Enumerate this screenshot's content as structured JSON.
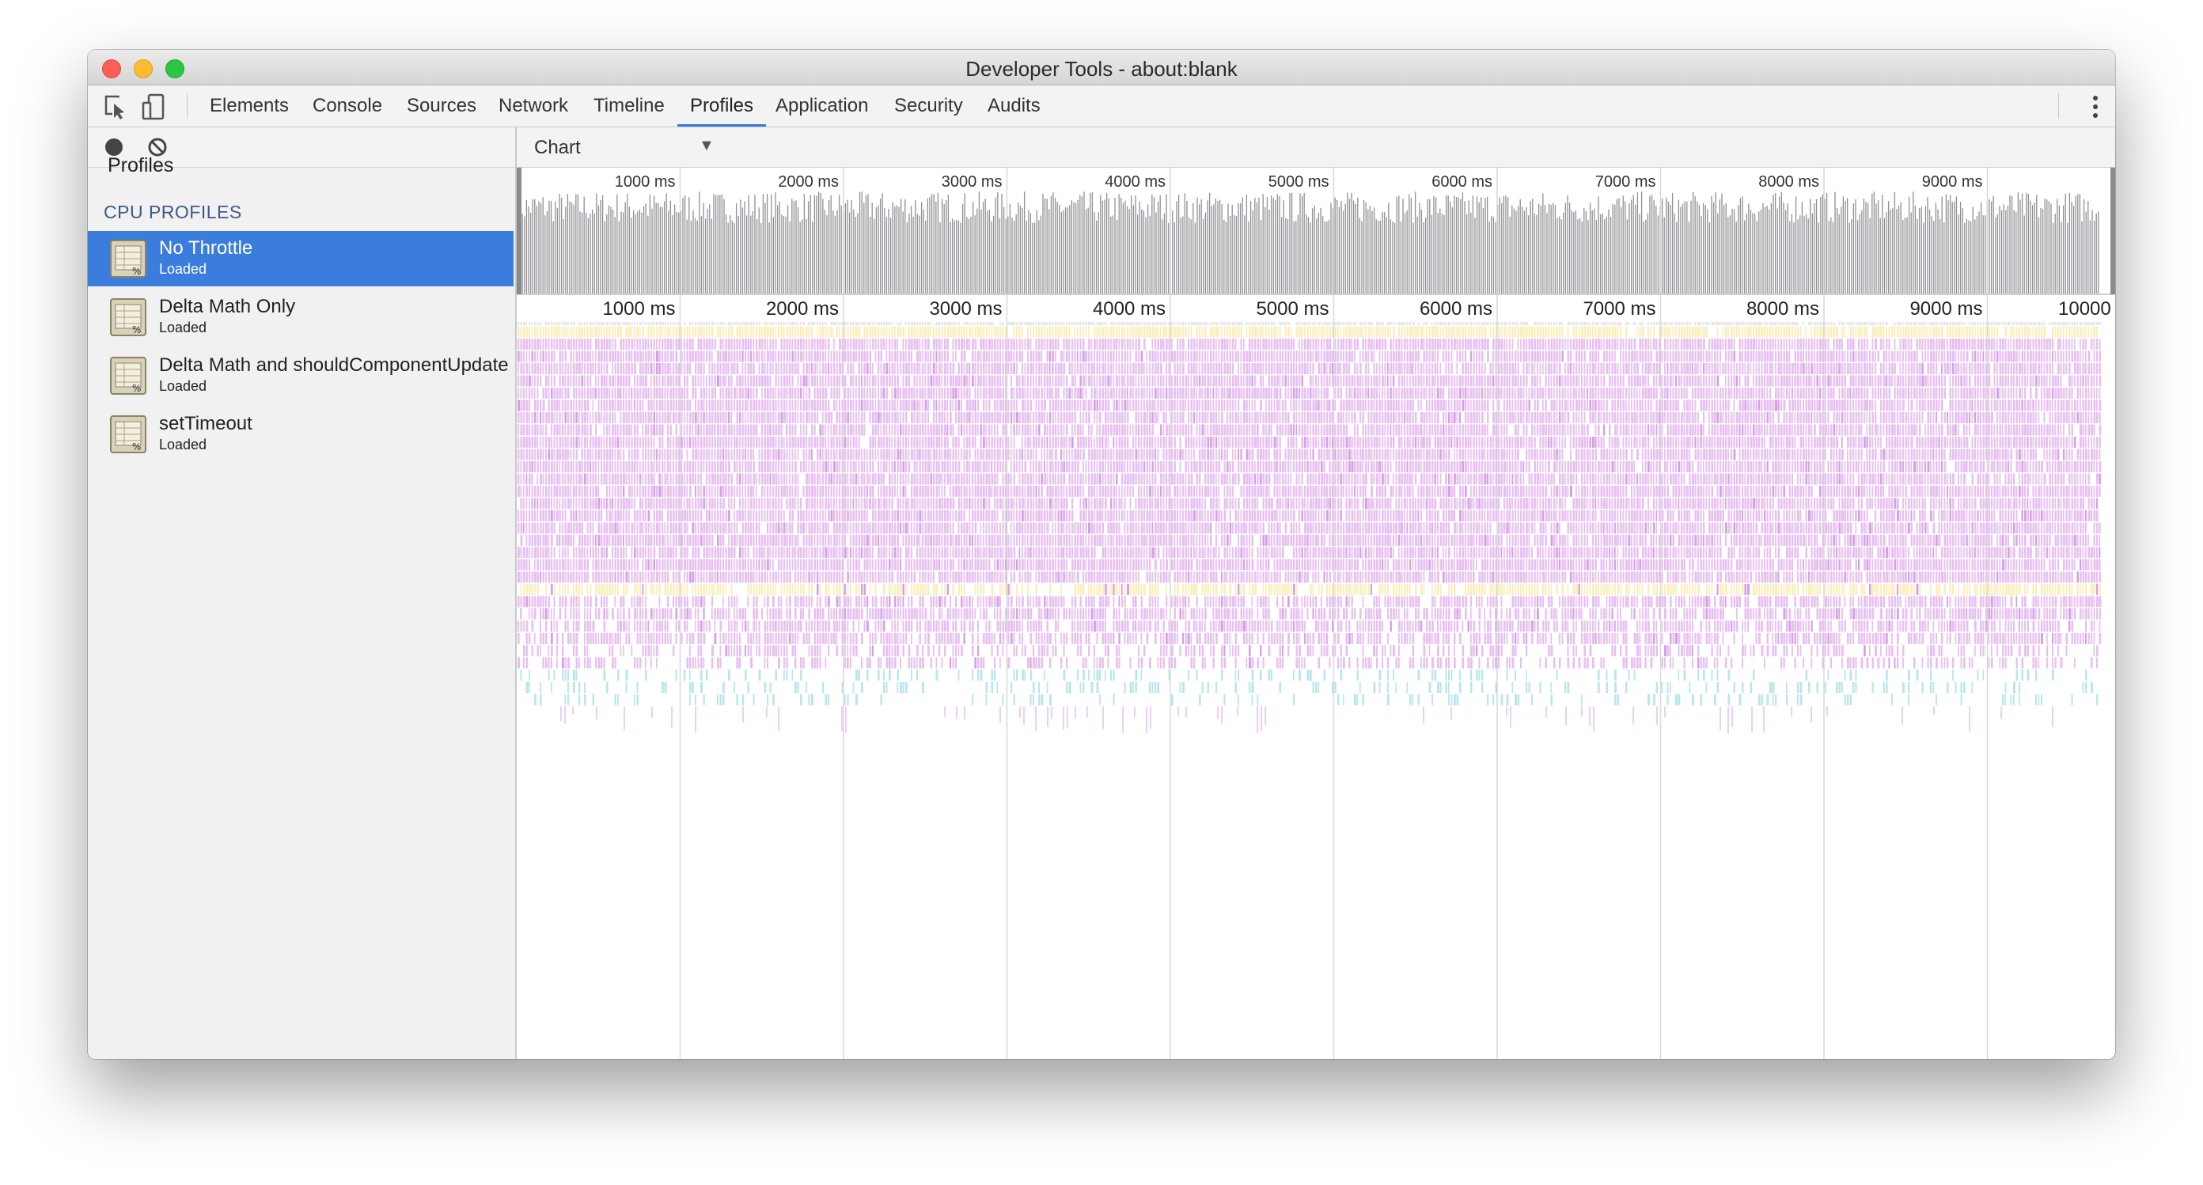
{
  "window": {
    "title": "Developer Tools - about:blank"
  },
  "toolbar": {
    "icons": [
      "inspect-element-icon",
      "device-toolbar-icon",
      "more-options-icon"
    ],
    "tabs": [
      "Elements",
      "Console",
      "Sources",
      "Network",
      "Timeline",
      "Profiles",
      "Application",
      "Security",
      "Audits"
    ],
    "active_tab": "Profiles",
    "accent_color": "#3879d9"
  },
  "sidebar": {
    "toolbar_icons": [
      "record-icon",
      "clear-icon"
    ],
    "heading": "Profiles",
    "section": "CPU PROFILES",
    "profiles": [
      {
        "name": "No Throttle",
        "status": "Loaded",
        "selected": true
      },
      {
        "name": "Delta Math Only",
        "status": "Loaded",
        "selected": false
      },
      {
        "name": "Delta Math and shouldComponentUpdate",
        "status": "Loaded",
        "selected": false
      },
      {
        "name": "setTimeout",
        "status": "Loaded",
        "selected": false
      }
    ],
    "selection_color": "#3b7ddd"
  },
  "main": {
    "view_select": "Chart",
    "overview_ticks": [
      "1000 ms",
      "2000 ms",
      "3000 ms",
      "4000 ms",
      "5000 ms",
      "6000 ms",
      "7000 ms",
      "8000 ms",
      "9000 ms",
      "1000"
    ],
    "timeline_ticks": [
      "1000 ms",
      "2000 ms",
      "3000 ms",
      "4000 ms",
      "5000 ms",
      "6000 ms",
      "7000 ms",
      "8000 ms",
      "9000 ms",
      "10000"
    ],
    "flame_colors": {
      "overview": "#8f8f96",
      "row_gray": "#e4e4e8",
      "row_yellow": "#fbeebb",
      "purple": "#e7bff1",
      "purple_dark": "#d59ee6",
      "cyan": "#b9e6ec"
    }
  }
}
